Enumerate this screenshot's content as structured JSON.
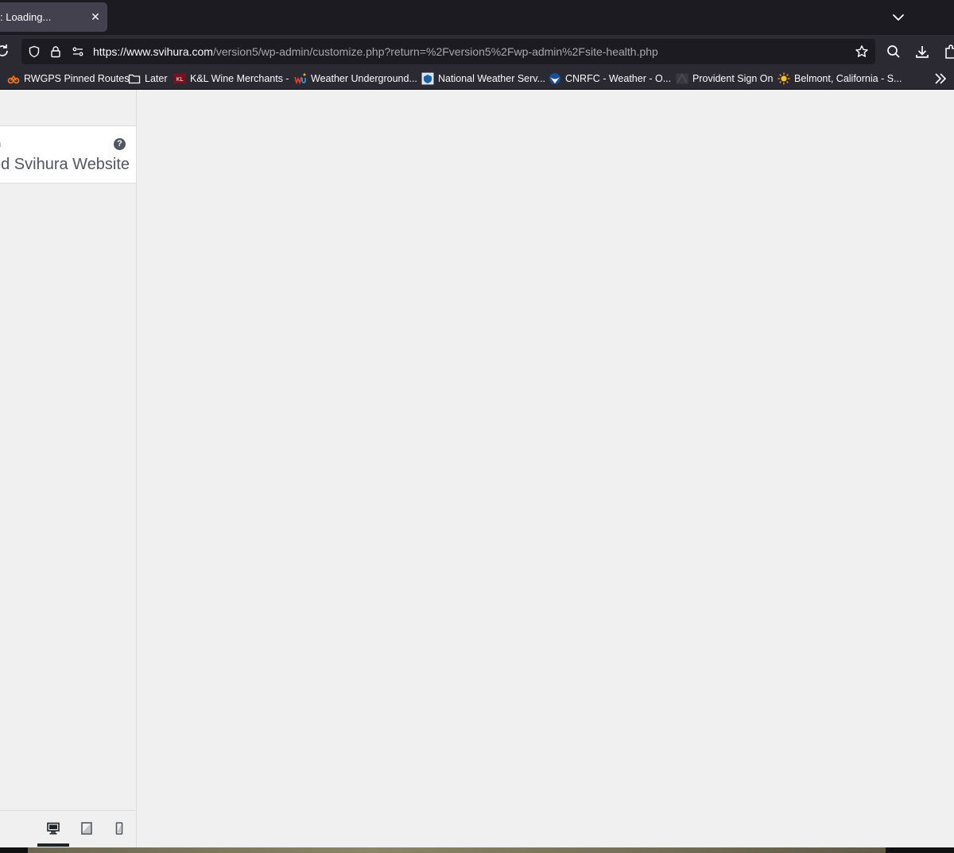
{
  "tab": {
    "title": ": Loading...",
    "close_glyph": "✕"
  },
  "navbar": {
    "url_host": "https://www.svihura.com",
    "url_path": "/version5/wp-admin/customize.php?return=%2Fversion5%2Fwp-admin%2Fsite-health.php"
  },
  "bookmarks": [
    {
      "label": "RWGPS Pinned Routes",
      "icon": "rwgps-icon"
    },
    {
      "label": "Later",
      "icon": "folder-icon"
    },
    {
      "label": "K&L Wine Merchants -",
      "icon": "kl-wine-icon"
    },
    {
      "label": "Weather Underground...",
      "icon": "wu-icon"
    },
    {
      "label": "National Weather Serv...",
      "icon": "nws-icon"
    },
    {
      "label": "CNRFC - Weather - O...",
      "icon": "noaa-icon"
    },
    {
      "label": "Provident Sign On",
      "icon": "provident-icon"
    },
    {
      "label": "Belmont, California - S...",
      "icon": "sun-icon"
    }
  ],
  "customizer": {
    "card_label": "n",
    "site_title": "ed Svihura Website",
    "help_glyph": "?"
  },
  "colors": {
    "chrome_dark": "#1c1b22",
    "toolbar": "#2b2a33",
    "content_bg": "#f0f0f1",
    "wp_text": "#50575e"
  }
}
